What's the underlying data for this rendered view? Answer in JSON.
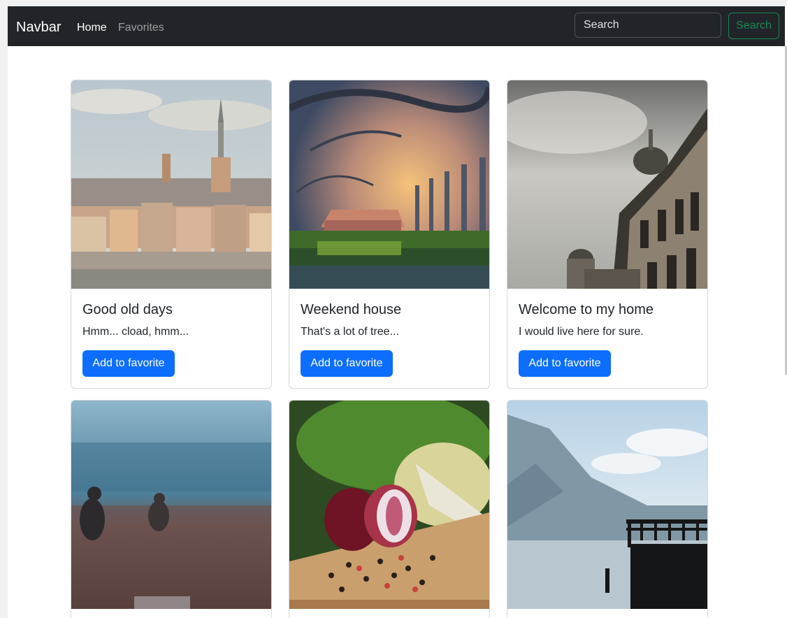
{
  "navbar": {
    "brand": "Navbar",
    "links": [
      "Home",
      "Favorites"
    ],
    "search_placeholder": "Search",
    "search_button": "Search"
  },
  "cards": [
    {
      "title": "Good old days",
      "text": "Hmm... cload, hmm...",
      "button": "Add to favorite",
      "image": "city-old-town-image"
    },
    {
      "title": "Weekend house",
      "text": "That's a lot of tree...",
      "button": "Add to favorite",
      "image": "tree-alley-sunset-image"
    },
    {
      "title": "Welcome to my home",
      "text": "I would live here for sure.",
      "button": "Add to favorite",
      "image": "palace-building-image"
    },
    {
      "title": "",
      "text": "",
      "button": "",
      "image": "foggy-field-image"
    },
    {
      "title": "",
      "text": "",
      "button": "",
      "image": "red-onion-vegetables-image"
    },
    {
      "title": "",
      "text": "",
      "button": "",
      "image": "lake-pier-mountains-image"
    }
  ],
  "colors": {
    "navbar_bg": "#212529",
    "primary": "#0d6efd",
    "success": "#198754"
  }
}
